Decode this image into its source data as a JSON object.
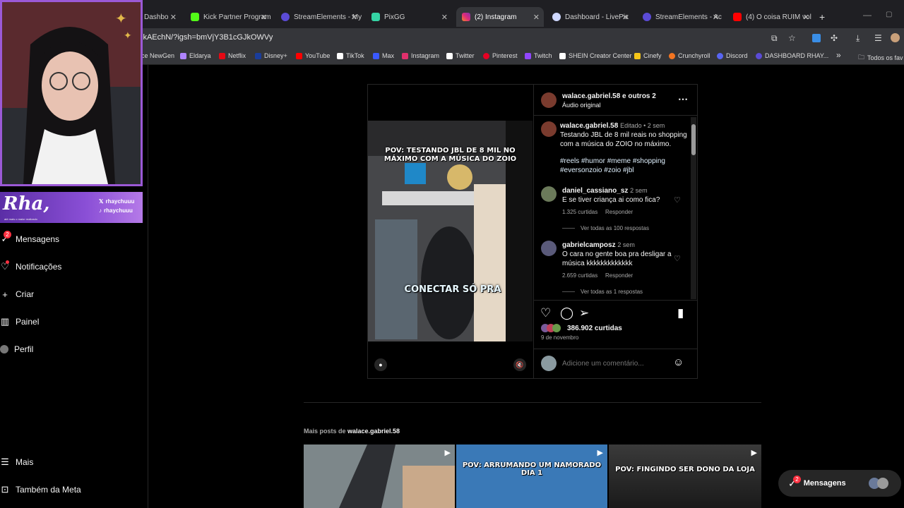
{
  "browser": {
    "tabs": [
      {
        "label": "Dashbo",
        "fav_color": "#8a6bff"
      },
      {
        "label": "Kick Partner Program",
        "fav_color": "#53fc18"
      },
      {
        "label": "StreamElements - My",
        "fav_color": "#5b4bd6"
      },
      {
        "label": "PixGG",
        "fav_color": "#35d4a5"
      },
      {
        "label": "(2) Instagram",
        "fav_color": "#e1306c"
      },
      {
        "label": "Dashboard - LivePix",
        "fav_color": "#cfd8ff"
      },
      {
        "label": "StreamElements - Ac",
        "fav_color": "#5b4bd6"
      },
      {
        "label": "(4) O coisa RUIM vol",
        "fav_color": "#ff0000"
      }
    ],
    "new_tab": "+",
    "url": "jkAEchN/?igsh=bmVjY3B1cGJkOWVy",
    "bookmarks": [
      {
        "label": "ce NewGen",
        "color": "#888888"
      },
      {
        "label": "Eldarya",
        "color": "#b084ff"
      },
      {
        "label": "Netflix",
        "color": "#e50914"
      },
      {
        "label": "Disney+",
        "color": "#1a3d9c"
      },
      {
        "label": "YouTube",
        "color": "#ff0000"
      },
      {
        "label": "TikTok",
        "color": "#ffffff"
      },
      {
        "label": "Max",
        "color": "#3a59ff"
      },
      {
        "label": "Instagram",
        "color": "#e1306c"
      },
      {
        "label": "Twitter",
        "color": "#ffffff"
      },
      {
        "label": "Pinterest",
        "color": "#e60023"
      },
      {
        "label": "Twitch",
        "color": "#9146ff"
      },
      {
        "label": "SHEIN Creator Center",
        "color": "#ffffff"
      },
      {
        "label": "Cinefy",
        "color": "#f5c518"
      },
      {
        "label": "Crunchyroll",
        "color": "#f47521"
      },
      {
        "label": "Discord",
        "color": "#5865f2"
      },
      {
        "label": "DASHBOARD RHAY...",
        "color": "#5b4bd6"
      }
    ],
    "bookmarks_more": "»",
    "all_bookmarks": "Todos os fav"
  },
  "overlay": {
    "banner_name": "Rha,",
    "handle1": "rhaychuuu",
    "handle2": "rhaychuuu",
    "sub": "até mais o maior realizado"
  },
  "sidebar": {
    "items": [
      {
        "label": "Mensagens",
        "icon": "messenger-icon",
        "badge": "2"
      },
      {
        "label": "Notificações",
        "icon": "heart-icon"
      },
      {
        "label": "Criar",
        "icon": "plus-icon"
      },
      {
        "label": "Painel",
        "icon": "chart-icon"
      },
      {
        "label": "Perfil",
        "icon": "profile-icon"
      }
    ],
    "more": "Mais",
    "meta": "Também da Meta"
  },
  "post": {
    "header_user": "walace.gabriel.58 e outros 2",
    "header_audio": "Áudio original",
    "video_caption_top": "POV: TESTANDO JBL DE 8 MIL NO MÁXIMO COM A MÚSICA DO ZOIO",
    "video_caption_bottom": "CONECTAR SÓ PRA",
    "caption_user": "walace.gabriel.58",
    "caption_meta": "Editado • 2 sem",
    "caption_text": "Testando JBL de 8 mil reais no shopping com a música do ZOIO no máximo.",
    "caption_tags": "#reels #humor #meme #shopping #eversonzoio #zoio #jbl",
    "comments": [
      {
        "user": "daniel_cassiano_sz",
        "time": "2 sem",
        "text": "E se tiver criança ai como fica?",
        "likes": "1.325 curtidas",
        "reply": "Responder",
        "view_all": "Ver todas as 100 respostas"
      },
      {
        "user": "gabrielcamposz",
        "time": "2 sem",
        "text": "O cara no gente boa pra desligar a música kkkkkkkkkkkkk",
        "likes": "2.659 curtidas",
        "reply": "Responder",
        "view_all": "Ver todas as 1 respostas"
      }
    ],
    "likes": "386.902 curtidas",
    "date": "9 de novembro",
    "comment_placeholder": "Adicione um comentário..."
  },
  "more_posts": {
    "prefix": "Mais posts de ",
    "user": "walace.gabriel.58",
    "thumbs": [
      {
        "text": ""
      },
      {
        "text": "POV: ARRUMANDO UM NAMORADO DIA 1"
      },
      {
        "text": "POV: FINGINDO SER DONO DA LOJA"
      }
    ]
  },
  "floating_messages": {
    "label": "Mensagens",
    "badge": "2"
  },
  "colors": {
    "accent": "#0095f6",
    "badge": "#ff3040",
    "webcam_border": "#9b59d6"
  }
}
